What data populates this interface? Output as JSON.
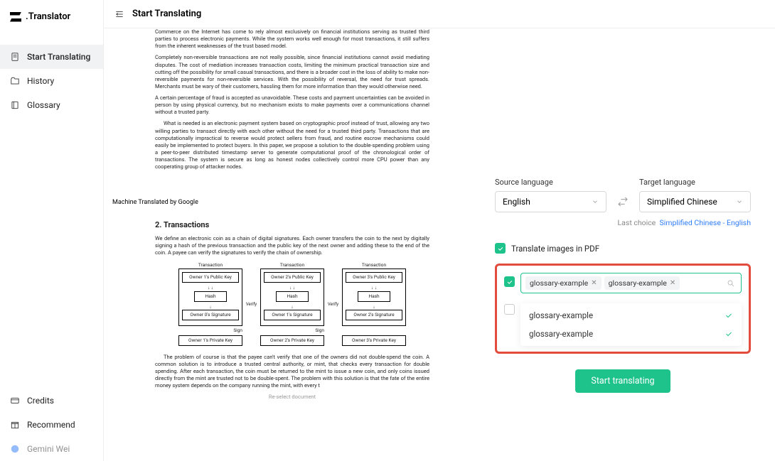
{
  "app": {
    "name": ".Translator"
  },
  "sidebar": {
    "items": [
      {
        "label": "Start Translating"
      },
      {
        "label": "History"
      },
      {
        "label": "Glossary"
      }
    ],
    "bottom": [
      {
        "label": "Credits"
      },
      {
        "label": "Recommend"
      },
      {
        "label": "Gemini Wei"
      }
    ]
  },
  "header": {
    "title": "Start Translating"
  },
  "document": {
    "p1": "Commerce on the Internet has come to rely almost exclusively on financial institutions serving as trusted third parties to process electronic payments. While the system works well enough for most transactions, it still suffers from the inherent weaknesses of the trust based model.",
    "p2": "Completely non-reversible transactions are not really possible, since financial institutions cannot avoid mediating disputes. The cost of mediation increases transaction costs, limiting the minimum practical transaction size and cutting off the possibility for small casual transactions, and there is a broader cost in the loss of ability to make non-reversible payments for non-reversible services. With the possibility of reversal, the need for trust spreads. Merchants must be wary of their customers, hassling them for more information than they would otherwise need.",
    "p3": "A certain percentage of fraud is accepted as unavoidable. These costs and payment uncertainties can be avoided in person by using physical currency, but no mechanism exists to make payments over a communications channel without a trusted party.",
    "p4": "What is needed is an electronic payment system based on cryptographic proof instead of trust, allowing any two willing parties to transact directly with each other without the need for a trusted third party. Transactions that are computationally impractical to reverse would protect sellers from fraud, and routine escrow mechanisms could easily be implemented to protect buyers. In this paper, we propose a solution to the double-spending problem using a peer-to-peer distributed timestamp server to generate computational proof of the chronological order of transactions. The system is secure as long as honest nodes collectively control more CPU power than any cooperating group of attacker nodes.",
    "mt": "Machine Translated by Google",
    "h2": "2. Transactions",
    "p5": "We define an electronic coin as a chain of digital signatures. Each owner transfers the coin to the next by digitally signing a hash of the previous transaction and the public key of the next owner and adding these to the end of the coin. A payee can verify the signatures to verify the chain of ownership.",
    "diagram": {
      "tx": "Transaction",
      "pk1": "Owner 1's Public Key",
      "pk2": "Owner 2's Public Key",
      "pk3": "Owner 3's Public Key",
      "hash": "Hash",
      "sig0": "Owner 0's Signature",
      "sig1": "Owner 1's Signature",
      "sig2": "Owner 2's Signature",
      "priv1": "Owner 1's Private Key",
      "priv2": "Owner 2's Private Key",
      "priv3": "Owner 3's Private Key",
      "verify": "Verify",
      "sign": "Sign"
    },
    "p6": "The problem of course is that the payee can't verify that one of the owners did not double-spend the coin. A common solution is to introduce a trusted central authority, or mint, that checks every transaction for double spending. After each transaction, the coin must be returned to the mint to issue a new coin, and only coins issued directly from the mint are trusted not to be double-spent. The problem with this solution is that the fate of the entire money system depends on the company running the mint, with every t",
    "reselect": "Re-select document"
  },
  "panel": {
    "source_label": "Source language",
    "target_label": "Target language",
    "source_value": "English",
    "target_value": "Simplified Chinese",
    "last_choice_label": "Last choice",
    "last_choice_value": "Simplified Chinese - English",
    "translate_images": "Translate images in PDF",
    "glossary_tags": [
      "glossary-example",
      "glossary-example"
    ],
    "glossary_options": [
      "glossary-example",
      "glossary-example"
    ],
    "start_button": "Start translating"
  }
}
